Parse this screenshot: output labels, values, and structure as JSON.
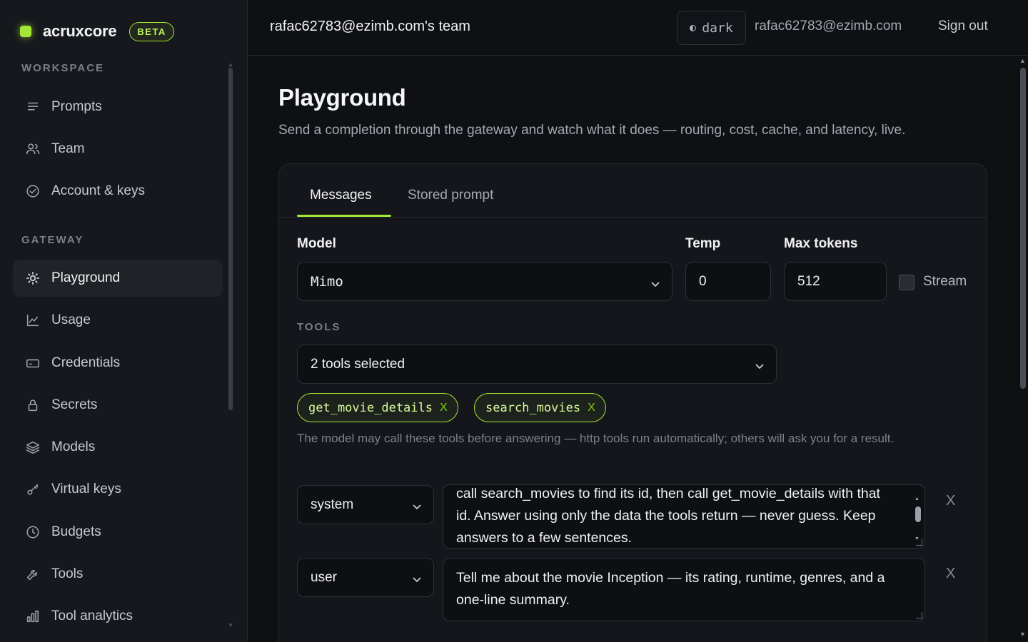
{
  "brand": {
    "name": "acruxcore",
    "badge": "BETA",
    "accent": "#a3e635"
  },
  "sidebar": {
    "sections": [
      {
        "title": "WORKSPACE",
        "items": [
          {
            "label": "Prompts",
            "icon": "list-icon"
          },
          {
            "label": "Team",
            "icon": "users-icon"
          },
          {
            "label": "Account & keys",
            "icon": "check-circle-icon"
          }
        ]
      },
      {
        "title": "GATEWAY",
        "items": [
          {
            "label": "Playground",
            "icon": "sun-icon",
            "active": true
          },
          {
            "label": "Usage",
            "icon": "line-chart-icon"
          },
          {
            "label": "Credentials",
            "icon": "card-icon"
          },
          {
            "label": "Secrets",
            "icon": "lock-icon"
          },
          {
            "label": "Models",
            "icon": "layers-icon"
          },
          {
            "label": "Virtual keys",
            "icon": "key-icon"
          },
          {
            "label": "Budgets",
            "icon": "clock-icon"
          },
          {
            "label": "Tools",
            "icon": "wrench-icon"
          },
          {
            "label": "Tool analytics",
            "icon": "bar-chart-icon"
          }
        ]
      }
    ]
  },
  "topbar": {
    "team": "rafac62783@ezimb.com's team",
    "theme": "dark",
    "email": "rafac62783@ezimb.com",
    "signout": "Sign out"
  },
  "page": {
    "title": "Playground",
    "subtitle": "Send a completion through the gateway and watch what it does — routing, cost, cache, and latency, live."
  },
  "tabs": [
    {
      "label": "Messages",
      "active": true
    },
    {
      "label": "Stored prompt",
      "active": false
    }
  ],
  "form": {
    "model_label": "Model",
    "model_value": "Mimo",
    "temp_label": "Temp",
    "temp_value": "0",
    "max_tokens_label": "Max tokens",
    "max_tokens_value": "512",
    "stream_label": "Stream",
    "stream_checked": false
  },
  "tools": {
    "caption": "TOOLS",
    "select_value": "2 tools selected",
    "chips": [
      "get_movie_details",
      "search_movies"
    ],
    "chip_remove": "X",
    "help": "The model may call these tools before answering — http tools run automatically; others will ask you for a result."
  },
  "messages": [
    {
      "role": "system",
      "content": "call search_movies to find its id, then call get_movie_details with that id. Answer using only the data the tools return — never guess. Keep answers to a few sentences."
    },
    {
      "role": "user",
      "content": "Tell me about the movie Inception — its rating, runtime, genres, and a one-line summary."
    }
  ],
  "remove_label": "X"
}
